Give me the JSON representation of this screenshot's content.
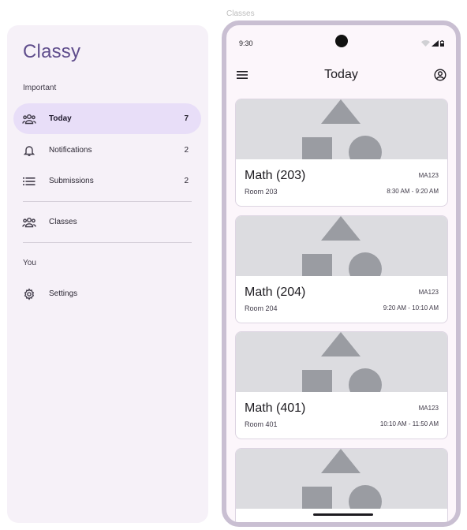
{
  "drawer": {
    "app_title": "Classy",
    "section_important": "Important",
    "section_you": "You",
    "items": [
      {
        "label": "Today",
        "count": "7",
        "icon": "people-icon",
        "active": true
      },
      {
        "label": "Notifications",
        "count": "2",
        "icon": "bell-icon",
        "active": false
      },
      {
        "label": "Submissions",
        "count": "2",
        "icon": "list-icon",
        "active": false
      },
      {
        "label": "Classes",
        "count": "",
        "icon": "people-icon",
        "active": false
      },
      {
        "label": "Settings",
        "count": "",
        "icon": "gear-icon",
        "active": false
      }
    ]
  },
  "frame": {
    "caption": "Classes"
  },
  "phone": {
    "time": "9:30",
    "title": "Today",
    "cards": [
      {
        "title": "Math (203)",
        "code": "MA123",
        "room": "Room 203",
        "time": "8:30 AM - 9:20 AM"
      },
      {
        "title": "Math (204)",
        "code": "MA123",
        "room": "Room 204",
        "time": "9:20 AM - 10:10 AM"
      },
      {
        "title": "Math (401)",
        "code": "MA123",
        "room": "Room 401",
        "time": "10:10 AM - 11:50 AM"
      },
      {
        "title": "",
        "code": "",
        "room": "",
        "time": ""
      }
    ]
  },
  "colors": {
    "accent": "#5f4d8c",
    "active_bg": "#e8def8",
    "drawer_bg": "#f6f1f8",
    "frame": "#c9bfd2",
    "placeholder_shape": "#9a9ca2",
    "placeholder_bg": "#dcdce0"
  }
}
